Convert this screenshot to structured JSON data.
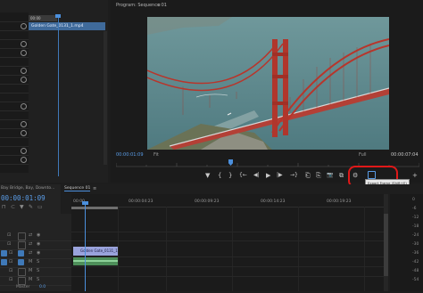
{
  "source_panel": {
    "label": "00:00",
    "clip_name": "Golden Gate_0131_1.mp4"
  },
  "program_monitor": {
    "title": "Program: Sequence 01",
    "menu_icon": "menu-icon",
    "timecode_current": "00:00:01:09",
    "fit_label": "Fit",
    "resolution_label": "Full",
    "timecode_duration": "00:00:07:04",
    "tooltip": "Export Frame (Shift+E)",
    "transport": {
      "marker": "▼",
      "in": "{",
      "out": "}",
      "go_in": "{←",
      "step_back": "◀|",
      "play": "▶",
      "step_fwd": "|▶",
      "go_out": "→}",
      "lift": "⎗",
      "extract": "⎘",
      "export_frame": "📷",
      "comparison": "⧉",
      "settings": "⚙"
    }
  },
  "project_panel": {
    "tab_label": "Bay Bridge, Bay, Downto..."
  },
  "timeline": {
    "tab_label": "Sequence 01",
    "close_glyph": "≡",
    "timecode": "00:00:01:09",
    "ticks": [
      "00:00",
      "00:00:04:23",
      "00:00:09:23",
      "00:00:14:23",
      "00:00:19:23",
      "00:00:24:23"
    ],
    "clip_label": "Golden Gate_0131_1.mp4",
    "tracks": [
      "V3",
      "V2",
      "V1",
      "A1",
      "A2",
      "A3"
    ],
    "master_label": "Master",
    "master_value": "0.0"
  },
  "colors": {
    "accent_blue": "#4b8fdc",
    "highlight_red": "#e01818",
    "video_clip": "#9aa3dc",
    "audio_clip": "#4e8f5a"
  },
  "meter_labels": [
    "0",
    "-6",
    "-12",
    "-18",
    "-24",
    "-30",
    "-36",
    "-42",
    "-48",
    "-54",
    "dB"
  ]
}
